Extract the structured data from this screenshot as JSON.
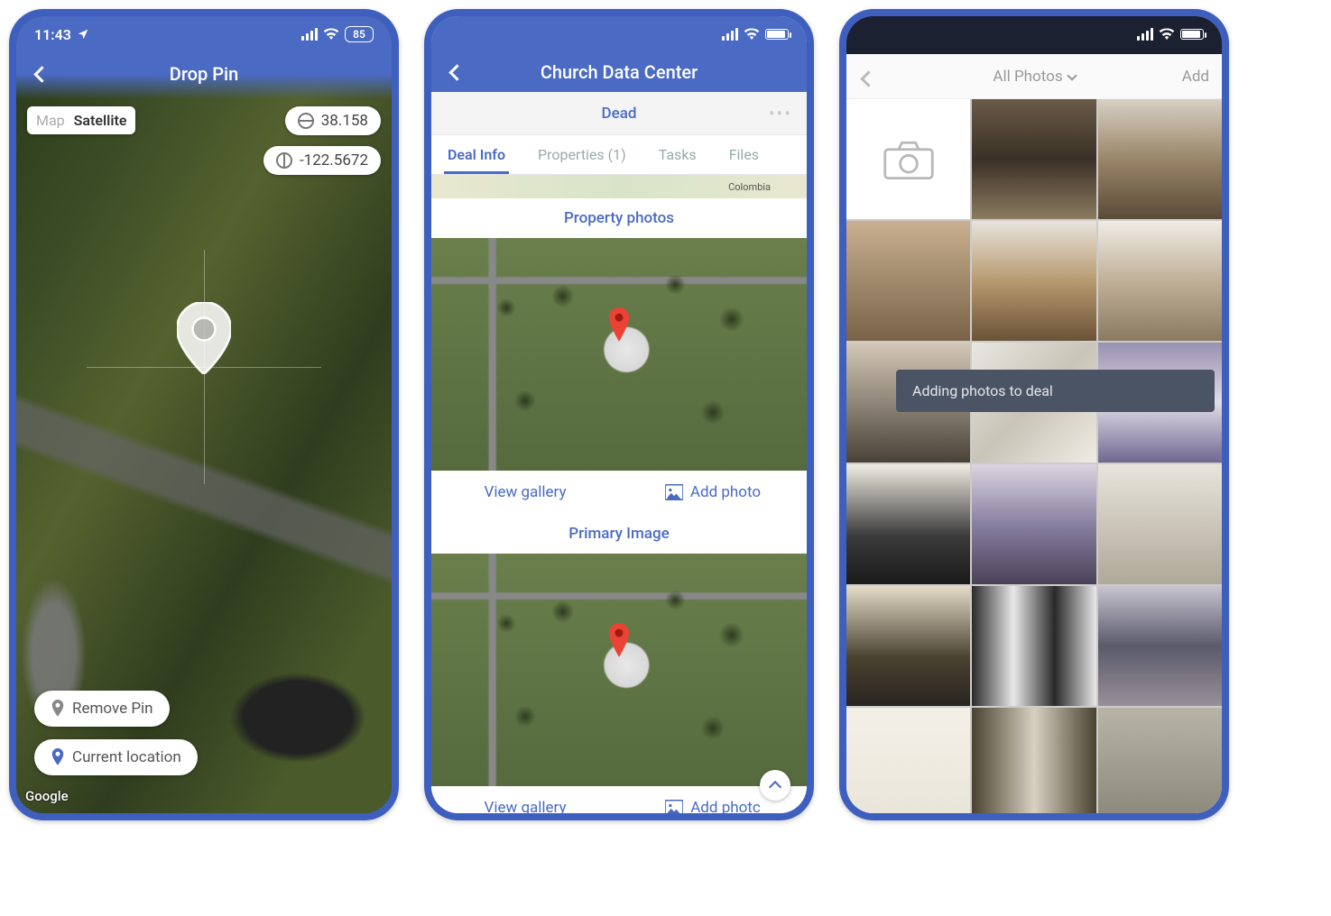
{
  "colors": {
    "primary": "#4a6ac3",
    "accent_red": "#ea4335",
    "text_muted": "#9aa0a6"
  },
  "screen1": {
    "status": {
      "time": "11:43",
      "battery_pct": "85"
    },
    "nav_title": "Drop Pin",
    "map_type": {
      "map_label": "Map",
      "satellite_label": "Satellite",
      "selected": "Satellite"
    },
    "coords": {
      "lat": "38.158",
      "lng": "-122.5672"
    },
    "actions": {
      "remove_pin": "Remove Pin",
      "current_location": "Current location"
    },
    "watermark": "Google"
  },
  "screen2": {
    "nav_title": "Church Data Center",
    "status_label": "Dead",
    "tabs": [
      {
        "label": "Deal Info",
        "active": true
      },
      {
        "label": "Properties (1)",
        "active": false
      },
      {
        "label": "Tasks",
        "active": false
      },
      {
        "label": "Files",
        "active": false
      }
    ],
    "map_strip_label": "Colombia",
    "sections": {
      "property_photos": "Property photos",
      "primary_image": "Primary Image"
    },
    "actions": {
      "view_gallery": "View gallery",
      "add_photo": "Add photo",
      "add_photo_cut": "Add photc"
    }
  },
  "screen3": {
    "nav": {
      "title": "All Photos",
      "add_label": "Add"
    },
    "toast": "Adding photos to deal",
    "tiles": [
      "camera",
      "kitchen-commercial-1",
      "kitchen-commercial-2",
      "wood-interior",
      "kitchen-island",
      "hallway-light",
      "auditorium",
      "office-open",
      "atrium-dark",
      "lobby-tall",
      "reception",
      "cafe-corner",
      "corridor-white",
      "glass-walls",
      "interior-glass",
      "open-hall",
      "facade-windows",
      "misc"
    ]
  }
}
